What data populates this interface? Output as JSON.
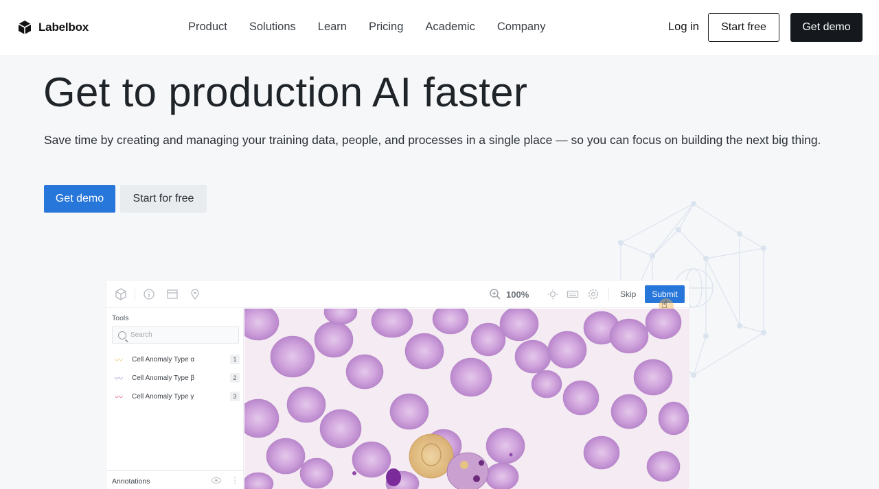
{
  "nav": {
    "brand": "Labelbox",
    "links": [
      "Product",
      "Solutions",
      "Learn",
      "Pricing",
      "Academic",
      "Company"
    ],
    "login": "Log in",
    "start_free": "Start free",
    "get_demo": "Get demo"
  },
  "hero": {
    "title": "Get to production AI faster",
    "subtitle": "Save time by creating and managing your training data, people, and processes in a single place — so you can focus on building the next big thing.",
    "primary_cta": "Get demo",
    "secondary_cta": "Start for free"
  },
  "app": {
    "zoom": "100%",
    "skip": "Skip",
    "submit": "Submit",
    "tools_label": "Tools",
    "search_placeholder": "Search",
    "tools": [
      {
        "name": "Cell Anomaly Type α",
        "key": "1",
        "color": "#e8c766"
      },
      {
        "name": "Cell Anomaly Type β",
        "key": "2",
        "color": "#9b8fd6"
      },
      {
        "name": "Cell Anomaly Type γ",
        "key": "3",
        "color": "#e0578a"
      }
    ],
    "annotations_label": "Annotations"
  },
  "colors": {
    "accent": "#2776d9",
    "dark": "#15191e",
    "cell": "#c99bd6"
  }
}
